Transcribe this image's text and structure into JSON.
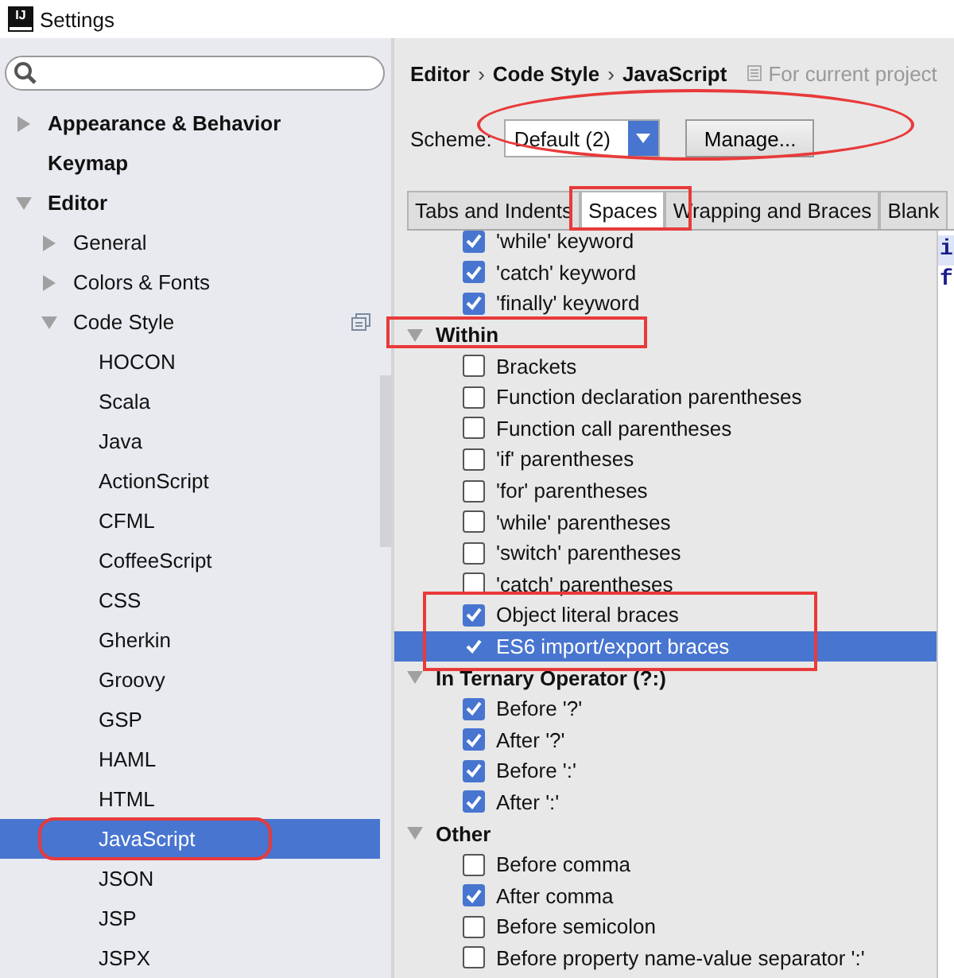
{
  "window": {
    "title": "Settings",
    "app_icon": "IJ"
  },
  "sidebar": {
    "items": [
      {
        "label": "Appearance & Behavior",
        "expanded": false,
        "selected": false
      },
      {
        "label": "Keymap",
        "selected": false
      },
      {
        "label": "Editor",
        "expanded": true,
        "selected": false,
        "children": [
          {
            "label": "General",
            "expanded": false,
            "selected": false
          },
          {
            "label": "Colors & Fonts",
            "expanded": false,
            "selected": false
          },
          {
            "label": "Code Style",
            "expanded": true,
            "selected": false,
            "project_icon": true,
            "children": [
              {
                "label": "HOCON",
                "selected": false
              },
              {
                "label": "Scala",
                "selected": false
              },
              {
                "label": "Java",
                "selected": false
              },
              {
                "label": "ActionScript",
                "selected": false
              },
              {
                "label": "CFML",
                "selected": false
              },
              {
                "label": "CoffeeScript",
                "selected": false
              },
              {
                "label": "CSS",
                "selected": false
              },
              {
                "label": "Gherkin",
                "selected": false
              },
              {
                "label": "Groovy",
                "selected": false
              },
              {
                "label": "GSP",
                "selected": false
              },
              {
                "label": "HAML",
                "selected": false
              },
              {
                "label": "HTML",
                "selected": false
              },
              {
                "label": "JavaScript",
                "selected": true
              },
              {
                "label": "JSON",
                "selected": false
              },
              {
                "label": "JSP",
                "selected": false
              },
              {
                "label": "JSPX",
                "selected": false
              }
            ]
          }
        ]
      }
    ]
  },
  "breadcrumb": {
    "parts": [
      "Editor",
      "Code Style",
      "JavaScript"
    ],
    "separator": "›",
    "scope": "For current project"
  },
  "scheme": {
    "label": "Scheme:",
    "value": "Default (2)",
    "button": "Manage..."
  },
  "tabs": [
    {
      "label": "Tabs and Indents",
      "selected": false
    },
    {
      "label": "Spaces",
      "selected": true
    },
    {
      "label": "Wrapping and Braces",
      "selected": false
    },
    {
      "label": "Blank",
      "selected": false
    }
  ],
  "sections": [
    {
      "items": [
        {
          "label": "'while' keyword",
          "checked": true,
          "selected": false
        },
        {
          "label": "'catch' keyword",
          "checked": true,
          "selected": false
        },
        {
          "label": "'finally' keyword",
          "checked": true,
          "selected": false
        }
      ]
    },
    {
      "header": "Within",
      "expanded": true,
      "items": [
        {
          "label": "Brackets",
          "checked": false,
          "selected": false
        },
        {
          "label": "Function declaration parentheses",
          "checked": false,
          "selected": false
        },
        {
          "label": "Function call parentheses",
          "checked": false,
          "selected": false
        },
        {
          "label": "'if' parentheses",
          "checked": false,
          "selected": false
        },
        {
          "label": "'for' parentheses",
          "checked": false,
          "selected": false
        },
        {
          "label": "'while' parentheses",
          "checked": false,
          "selected": false
        },
        {
          "label": "'switch' parentheses",
          "checked": false,
          "selected": false
        },
        {
          "label": "'catch' parentheses",
          "checked": false,
          "selected": false
        },
        {
          "label": "Object literal braces",
          "checked": true,
          "selected": false
        },
        {
          "label": "ES6 import/export braces",
          "checked": true,
          "selected": true
        }
      ]
    },
    {
      "header": "In Ternary Operator (?:)",
      "expanded": true,
      "items": [
        {
          "label": "Before '?'",
          "checked": true,
          "selected": false
        },
        {
          "label": "After '?'",
          "checked": true,
          "selected": false
        },
        {
          "label": "Before ':'",
          "checked": true,
          "selected": false
        },
        {
          "label": "After ':'",
          "checked": true,
          "selected": false
        }
      ]
    },
    {
      "header": "Other",
      "expanded": true,
      "items": [
        {
          "label": "Before comma",
          "checked": false,
          "selected": false
        },
        {
          "label": "After comma",
          "checked": true,
          "selected": false
        },
        {
          "label": "Before semicolon",
          "checked": false,
          "selected": false
        },
        {
          "label": "Before property name-value separator ':'",
          "checked": false,
          "selected": false
        }
      ]
    }
  ],
  "preview": {
    "lines": [
      "i",
      "f"
    ]
  }
}
